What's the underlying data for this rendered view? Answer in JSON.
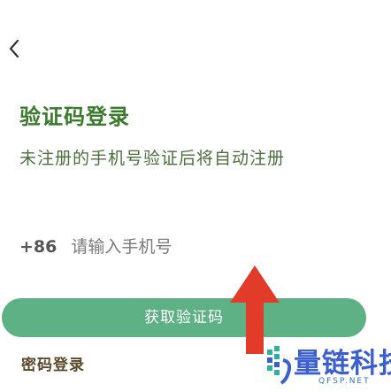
{
  "header": {
    "back_icon": "chevron-left-icon"
  },
  "login": {
    "title": "验证码登录",
    "subtitle": "未注册的手机号验证后将自动注册"
  },
  "phone": {
    "country_code": "+86",
    "placeholder": "请输入手机号",
    "value": ""
  },
  "actions": {
    "get_code_label": "获取验证码",
    "password_login_label": "密码登录"
  },
  "overlay": {
    "arrow_color": "#e23b2a",
    "watermark_text": "量链科技",
    "watermark_sub": "QFSP.NET"
  },
  "colors": {
    "accent": "#5eb085",
    "title": "#3a7a2c"
  }
}
